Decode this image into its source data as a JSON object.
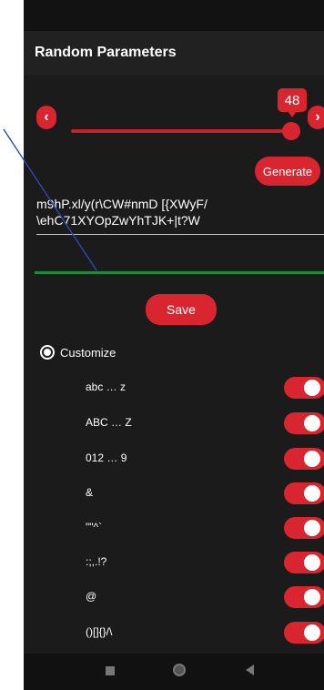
{
  "app": {
    "title": "Random Parameters"
  },
  "length_slider": {
    "value": "48",
    "decrease_icon": "chevron-left-icon",
    "increase_icon": "chevron-right-icon",
    "accent": "#d9252f"
  },
  "buttons": {
    "generate": "Generate",
    "save": "Save"
  },
  "password": {
    "text": "m9hP.xl/y(r\\CW#nmD [{XWyF/\n\\ehC71XYOpZwYhTJK+|t?W"
  },
  "strength": {
    "color": "#1f8a3d"
  },
  "customize": {
    "label": "Customize",
    "selected": true
  },
  "charsets": [
    {
      "label": "abc … z",
      "enabled": true
    },
    {
      "label": "ABC … Z",
      "enabled": true
    },
    {
      "label": "012 … 9",
      "enabled": true
    },
    {
      "label": "&",
      "enabled": true
    },
    {
      "label": "\"\"^`",
      "enabled": true
    },
    {
      "label": ":;,.!?",
      "enabled": true
    },
    {
      "label": "@",
      "enabled": true
    },
    {
      "label": "()[]{}/\\",
      "enabled": true
    }
  ]
}
